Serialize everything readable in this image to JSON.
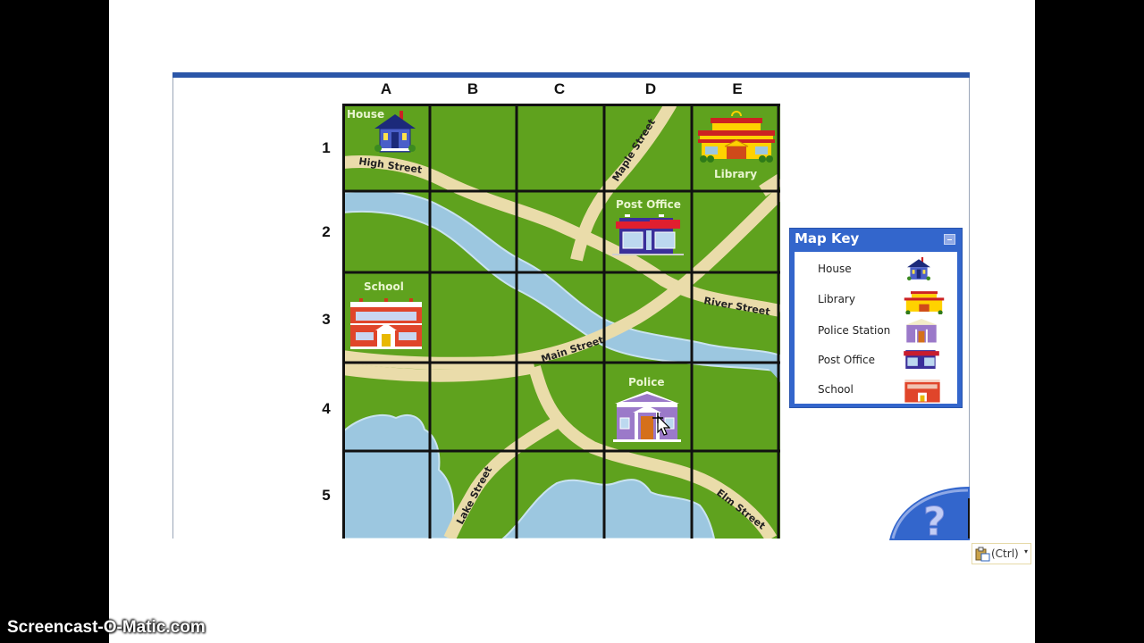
{
  "map": {
    "columns": [
      "A",
      "B",
      "C",
      "D",
      "E"
    ],
    "rows": [
      "1",
      "2",
      "3",
      "4",
      "5"
    ],
    "places": [
      {
        "label": "House",
        "cell": "A1",
        "icon": "house-icon"
      },
      {
        "label": "Library",
        "cell": "E1",
        "icon": "library-icon"
      },
      {
        "label": "Post Office",
        "cell": "D2",
        "icon": "post-office-icon"
      },
      {
        "label": "School",
        "cell": "A3",
        "icon": "school-icon"
      },
      {
        "label": "Police",
        "cell": "D4",
        "icon": "police-station-icon"
      }
    ],
    "streets": [
      "High Street",
      "Maple Street",
      "River Street",
      "Main Street",
      "Lake Street",
      "Elm Street"
    ],
    "colors": {
      "grass": "#5fa21e",
      "road": "#eadcaa",
      "water": "#9cc7e0",
      "grid": "#111111",
      "accent": "#3366cc"
    }
  },
  "map_key": {
    "title": "Map Key",
    "minimize_label": "minimize",
    "items": [
      {
        "label": "House",
        "icon": "house-icon"
      },
      {
        "label": "Library",
        "icon": "library-icon"
      },
      {
        "label": "Police Station",
        "icon": "police-station-icon"
      },
      {
        "label": "Post Office",
        "icon": "post-office-icon"
      },
      {
        "label": "School",
        "icon": "school-icon"
      }
    ]
  },
  "help": {
    "glyph": "?"
  },
  "paste_options": {
    "label": "(Ctrl)",
    "caret": "▾"
  },
  "watermark": "Screencast-O-Matic.com"
}
